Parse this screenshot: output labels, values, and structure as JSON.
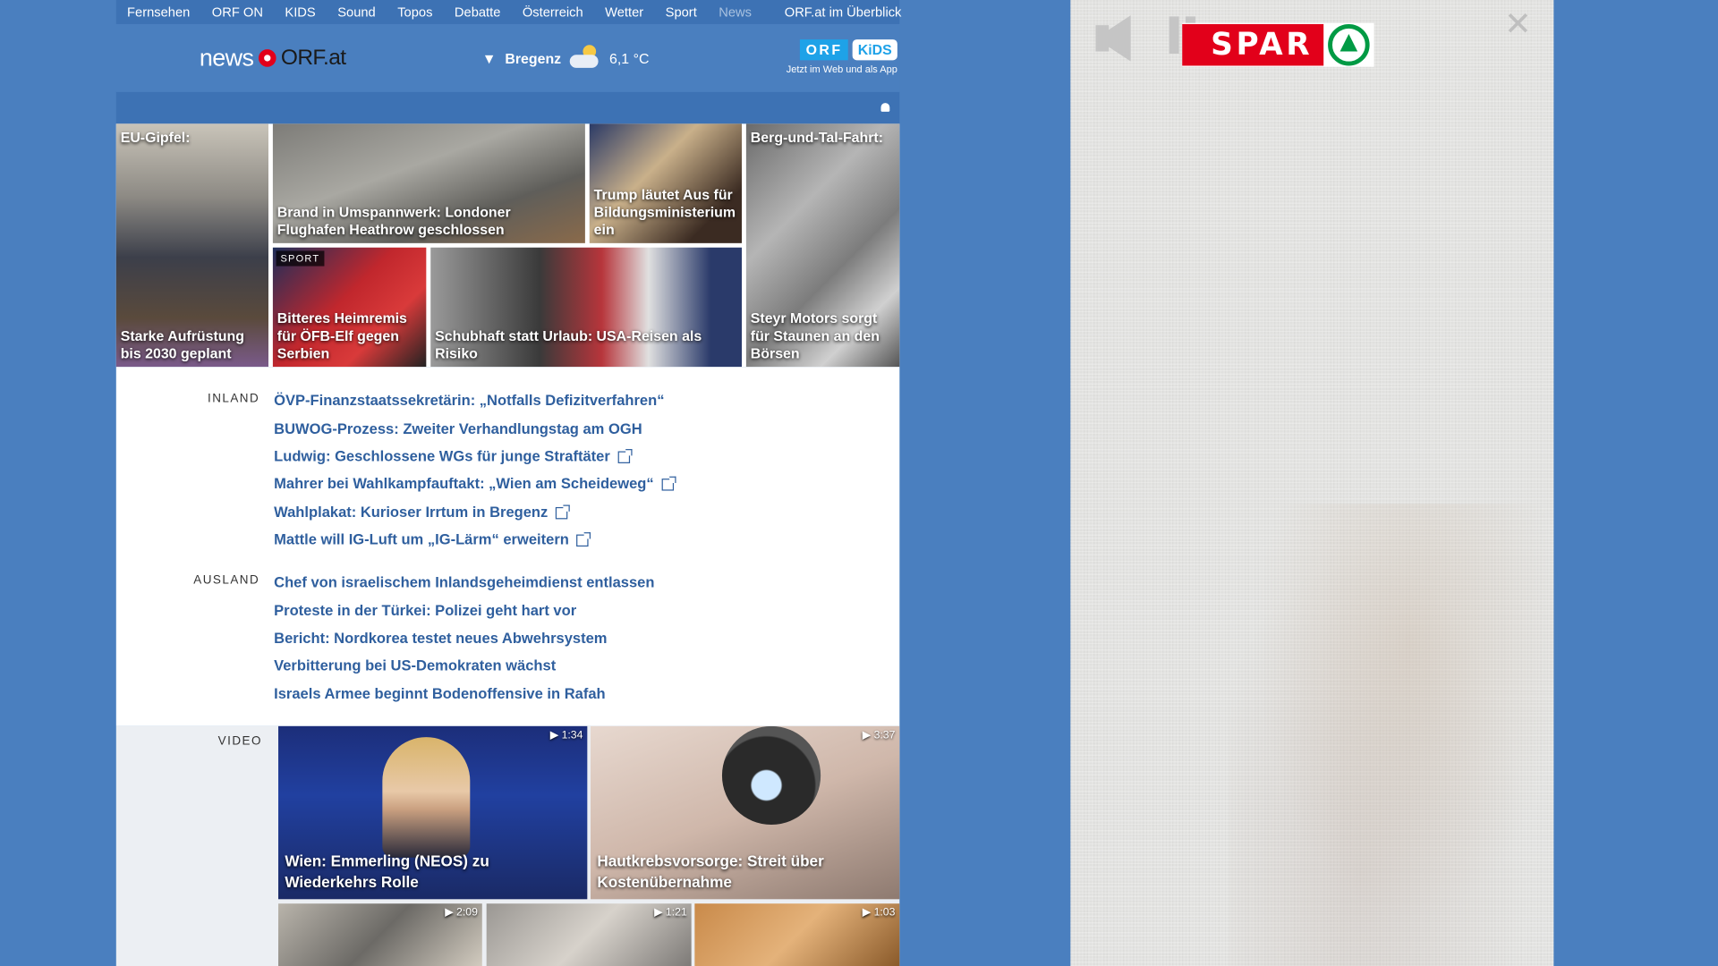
{
  "nav": {
    "items": [
      "Fernsehen",
      "ORF ON",
      "KIDS",
      "Sound",
      "Topos",
      "Debatte",
      "Österreich",
      "Wetter",
      "Sport",
      "News"
    ],
    "current": "News",
    "overview": "ORF.at im Überblick"
  },
  "header": {
    "logo_news": "news",
    "logo_orf": "ORF.at",
    "weather_location": "Bregenz",
    "weather_temp": "6,1 °C",
    "orf_badge": "ORF",
    "kids_badge": "KiDS",
    "kids_sub": "Jetzt im Web und als App"
  },
  "tiles": {
    "t1_top": "EU-Gipfel:",
    "t1_caption": "Starke Aufrüstung bis 2030 geplant",
    "t2_caption": "Brand in Umspannwerk: Londoner Flughafen Heathrow geschlossen",
    "t3_caption": "Trump läutet Aus für Bildungsministerium ein",
    "t4_top": "Berg-und-Tal-Fahrt:",
    "t4_caption": "Steyr Motors sorgt für Staunen an den Börsen",
    "t5_tag": "SPORT",
    "t5_caption": "Bitteres Heimremis für ÖFB-Elf gegen Serbien",
    "t6_caption": "Schubhaft statt Urlaub: USA-Reisen als Risiko"
  },
  "inland": {
    "label": "INLAND",
    "items": [
      "ÖVP-Finanzstaatssekretärin: „Notfalls Defizitverfahren“",
      "BUWOG-Prozess: Zweiter Verhandlungstag am OGH",
      "Ludwig: Geschlossene WGs für junge Straftäter",
      "Mahrer bei Wahlkampfauftakt: „Wien am Scheideweg“",
      "Wahlplakat: Kurioser Irrtum in Bregenz",
      "Mattle will IG-Luft um „IG-Lärm“ erweitern"
    ]
  },
  "ausland": {
    "label": "AUSLAND",
    "items": [
      "Chef von israelischem Inlandsgeheimdienst entlassen",
      "Proteste in der Türkei: Polizei geht hart vor",
      "Bericht: Nordkorea testet neues Abwehrsystem",
      "Verbitterung bei US-Demokraten wächst",
      "Israels Armee beginnt Bodenoffensive in Rafah"
    ]
  },
  "video": {
    "label": "VIDEO",
    "v1_duration": "▶ 1:34",
    "v1_caption": "Wien: Emmerling (NEOS) zu Wiederkehrs Rolle",
    "v2_duration": "▶ 3:37",
    "v2_caption": "Hautkrebsvorsorge: Streit über Kostenübernahme",
    "v3_duration": "▶ 2:09",
    "v4_duration": "▶ 1:21",
    "v5_duration": "▶ 1:03"
  },
  "ad": {
    "brand": "SPAR",
    "close_glyph": "✕"
  },
  "colors": {
    "page_bg": "#4a7fbf",
    "nav_bg": "#3d72b4",
    "link": "#2f5f9e",
    "orf_red": "#e2001a",
    "spar_green": "#009a44"
  }
}
